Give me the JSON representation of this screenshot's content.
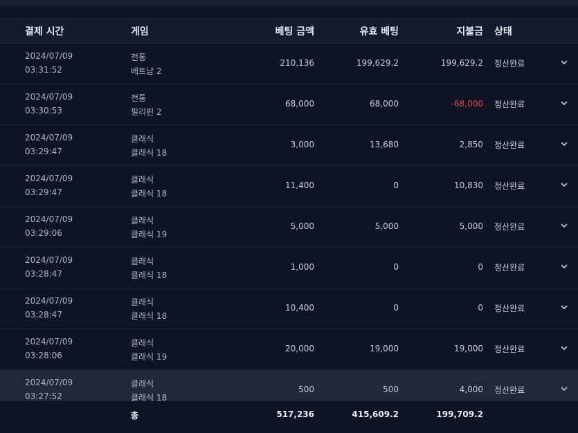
{
  "headers": {
    "time": "결제 시간",
    "game": "게임",
    "bet": "베팅 금액",
    "valid": "유효 베팅",
    "payout": "지불금",
    "status": "상태"
  },
  "rows": [
    {
      "date": "2024/07/09",
      "time": "03:31:52",
      "game_type": "전통",
      "game_name": "베트남 2",
      "bet": "210,136",
      "valid": "199,629.2",
      "payout": "199,629.2",
      "status": "정산완료",
      "negative": false
    },
    {
      "date": "2024/07/09",
      "time": "03:30:53",
      "game_type": "전통",
      "game_name": "필리핀 2",
      "bet": "68,000",
      "valid": "68,000",
      "payout": "-68,000",
      "status": "정산완료",
      "negative": true
    },
    {
      "date": "2024/07/09",
      "time": "03:29:47",
      "game_type": "클래식",
      "game_name": "클래식 18",
      "bet": "3,000",
      "valid": "13,680",
      "payout": "2,850",
      "status": "정산완료",
      "negative": false
    },
    {
      "date": "2024/07/09",
      "time": "03:29:47",
      "game_type": "클래식",
      "game_name": "클래식 18",
      "bet": "11,400",
      "valid": "0",
      "payout": "10,830",
      "status": "정산완료",
      "negative": false
    },
    {
      "date": "2024/07/09",
      "time": "03:29:06",
      "game_type": "클래식",
      "game_name": "클래식 19",
      "bet": "5,000",
      "valid": "5,000",
      "payout": "5,000",
      "status": "정산완료",
      "negative": false
    },
    {
      "date": "2024/07/09",
      "time": "03:28:47",
      "game_type": "클래식",
      "game_name": "클래식 18",
      "bet": "1,000",
      "valid": "0",
      "payout": "0",
      "status": "정산완료",
      "negative": false
    },
    {
      "date": "2024/07/09",
      "time": "03:28:47",
      "game_type": "클래식",
      "game_name": "클래식 18",
      "bet": "10,400",
      "valid": "0",
      "payout": "0",
      "status": "정산완료",
      "negative": false
    },
    {
      "date": "2024/07/09",
      "time": "03:28:06",
      "game_type": "클래식",
      "game_name": "클래식 19",
      "bet": "20,000",
      "valid": "19,000",
      "payout": "19,000",
      "status": "정산완료",
      "negative": false
    },
    {
      "date": "2024/07/09",
      "time": "03:27:52",
      "game_type": "클래식",
      "game_name": "클래식 18",
      "bet": "500",
      "valid": "500",
      "payout": "4,000",
      "status": "정산완료",
      "negative": false,
      "highlight": true
    }
  ],
  "total": {
    "label": "총",
    "bet": "517,236",
    "valid": "415,609.2",
    "payout": "199,709.2"
  },
  "colors": {
    "background": "#0f1424",
    "header": "#151b2c",
    "negative": "#e0454b",
    "highlight_row": "#22283a"
  },
  "icons": {
    "expand": "chevron-down-icon"
  }
}
